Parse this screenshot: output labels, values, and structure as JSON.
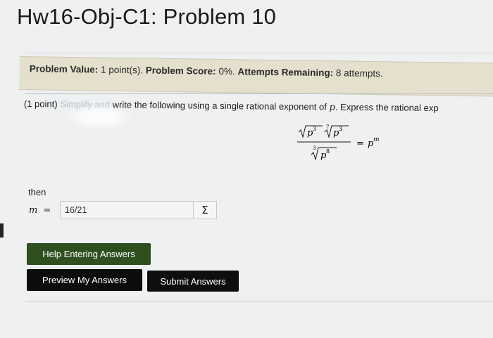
{
  "page": {
    "title": "Hw16-Obj-C1: Problem 10"
  },
  "info_bar": {
    "value_label": "Problem Value:",
    "value": "1 point(s).",
    "score_label": "Problem Score:",
    "score": "0%.",
    "attempts_label": "Attempts Remaining:",
    "attempts": "8 attempts."
  },
  "problem": {
    "points": "(1 point)",
    "faded_text": "Simplify and",
    "text": "write the following using a single rational exponent of",
    "variable": "p",
    "text_after": ". Express the rational exp",
    "then_label": "then",
    "answer_var": "m",
    "answer_eq": "="
  },
  "answer": {
    "value": "16/21",
    "sigma_label": "Σ"
  },
  "buttons": {
    "help": "Help Entering Answers",
    "preview": "Preview My Answers",
    "submit": "Submit Answers"
  },
  "colors": {
    "info_bar": "#e4e0cd",
    "help_button": "#2f4f1f",
    "action_button": "#0c0c0c"
  }
}
